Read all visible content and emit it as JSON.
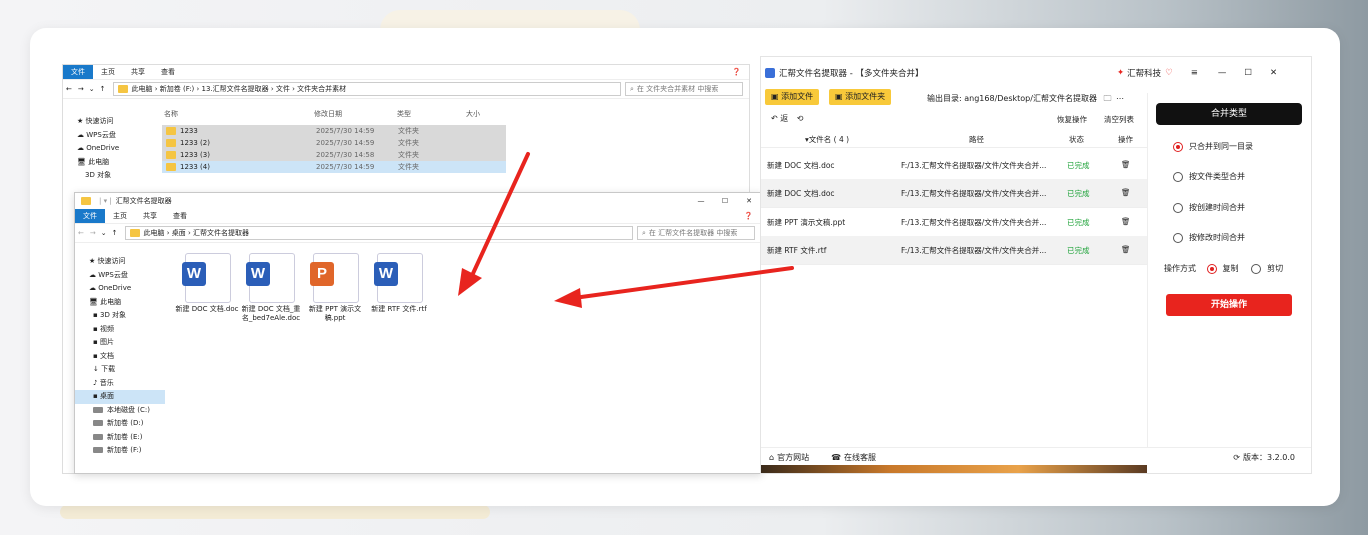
{
  "explorer_back": {
    "ribbon_tabs": [
      "文件",
      "主页",
      "共享",
      "查看"
    ],
    "address": [
      "此电脑",
      "新加卷 (F:)",
      "13.汇帮文件名提取器",
      "文件",
      "文件夹合并素材"
    ],
    "search_placeholder": "在 文件夹合并素材 中搜索",
    "columns": [
      "名称",
      "修改日期",
      "类型",
      "大小"
    ],
    "files": [
      {
        "name": "1233",
        "date": "2025/7/30 14:59",
        "type": "文件夹"
      },
      {
        "name": "1233 (2)",
        "date": "2025/7/30 14:59",
        "type": "文件夹"
      },
      {
        "name": "1233 (3)",
        "date": "2025/7/30 14:58",
        "type": "文件夹"
      },
      {
        "name": "1233 (4)",
        "date": "2025/7/30 14:59",
        "type": "文件夹"
      }
    ],
    "nav": [
      "快速访问",
      "WPS云盘",
      "OneDrive",
      "此电脑",
      "3D 对象"
    ]
  },
  "explorer_front": {
    "title": "汇帮文件名提取器",
    "ribbon_tabs": [
      "文件",
      "主页",
      "共享",
      "查看"
    ],
    "address": [
      "此电脑",
      "桌面",
      "汇帮文件名提取器"
    ],
    "search_placeholder": "在 汇帮文件名提取器 中搜索",
    "nav": [
      "快速访问",
      "WPS云盘",
      "OneDrive",
      "此电脑",
      "3D 对象",
      "视频",
      "图片",
      "文档",
      "下载",
      "音乐",
      "桌面",
      "本地磁盘 (C:)",
      "新加卷 (D:)",
      "新加卷 (E:)",
      "新加卷 (F:)"
    ],
    "files": [
      {
        "letter": "W",
        "name": "新建 DOC 文档.doc",
        "color": "#2b5eb8"
      },
      {
        "letter": "W",
        "name": "新建 DOC 文档_重名_bed7eAle.doc",
        "color": "#2b5eb8"
      },
      {
        "letter": "P",
        "name": "新建 PPT 演示文稿.ppt",
        "color": "#e0662a"
      },
      {
        "letter": "W",
        "name": "新建 RTF 文件.rtf",
        "color": "#2b5eb8"
      }
    ]
  },
  "app": {
    "title": "汇帮文件名提取器 - 【多文件夹合并】",
    "brand": "汇帮科技",
    "add_file": "添加文件",
    "add_folder": "添加文件夹",
    "output_label": "输出目录:",
    "output_path": "ang168/Desktop/汇帮文件名提取器",
    "toolbar": {
      "back": "返",
      "restore": "恢复操作",
      "clear": "清空列表"
    },
    "columns": {
      "name": "文件名 ( 4 )",
      "path": "路径",
      "status": "状态",
      "action": "操作"
    },
    "rows": [
      {
        "name": "新建 DOC 文档.doc",
        "path": "F:/13.汇帮文件名提取器/文件/文件夹合并...",
        "status": "已完成"
      },
      {
        "name": "新建 DOC 文档.doc",
        "path": "F:/13.汇帮文件名提取器/文件/文件夹合并...",
        "status": "已完成"
      },
      {
        "name": "新建 PPT 演示文稿.ppt",
        "path": "F:/13.汇帮文件名提取器/文件/文件夹合并...",
        "status": "已完成"
      },
      {
        "name": "新建 RTF 文件.rtf",
        "path": "F:/13.汇帮文件名提取器/文件/文件夹合并...",
        "status": "已完成"
      }
    ],
    "merge_type_label": "合并类型",
    "options": [
      "只合并到同一目录",
      "按文件类型合并",
      "按创建时间合并",
      "按修改时间合并"
    ],
    "selected_option": 0,
    "op_mode_label": "操作方式",
    "op_copy": "复制",
    "op_cut": "剪切",
    "start": "开始操作",
    "footer": {
      "website": "官方网站",
      "service": "在线客服",
      "version": "版本：3.2.0.0"
    },
    "colors": {
      "accent": "#e8241e",
      "yellow": "#f8c93a",
      "done": "#1fa33a"
    }
  }
}
